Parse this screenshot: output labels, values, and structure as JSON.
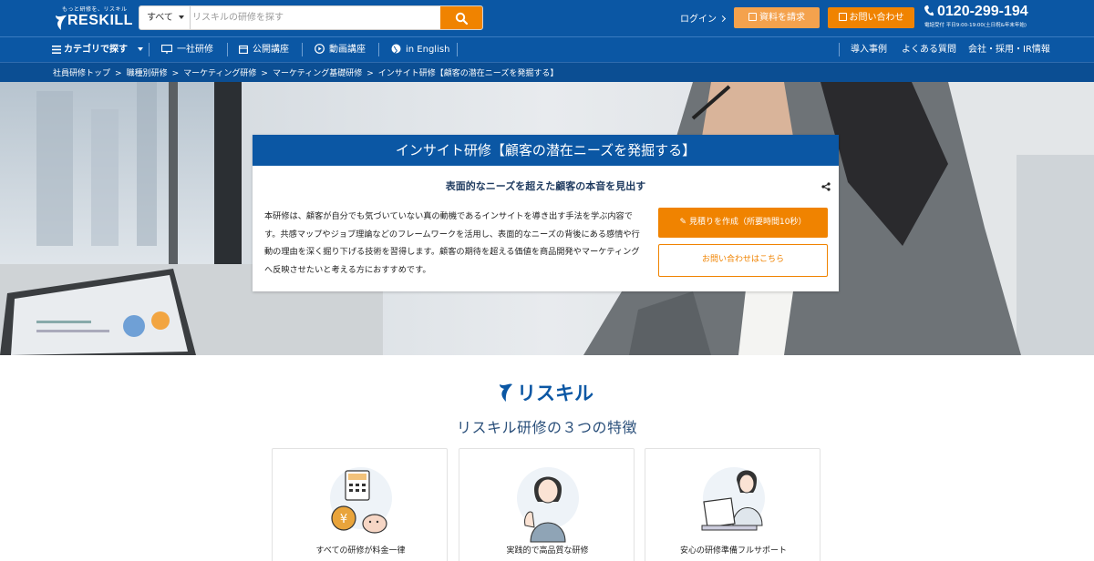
{
  "header": {
    "logo_tagline": "もっと研修を、リスキル",
    "logo_text": "RESKILL",
    "search": {
      "category": "すべて",
      "placeholder": "リスキルの研修を探す",
      "value": ""
    },
    "login_label": "ログイン",
    "request_docs_label": "資料を請求",
    "contact_label": "お問い合わせ",
    "phone_number": "0120-299-194",
    "phone_hours": "電話受付 平日9:00-19:00(土日祝&年末年始)"
  },
  "nav": {
    "categories_label": "カテゴリで探す",
    "items": [
      "一社研修",
      "公開講座",
      "動画講座",
      "in English"
    ],
    "right_items": [
      "導入事例",
      "よくある質問",
      "会社・採用・IR情報"
    ]
  },
  "breadcrumb": [
    "社員研修トップ",
    "職種別研修",
    "マーケティング研修",
    "マーケティング基礎研修",
    "インサイト研修【顧客の潜在ニーズを発掘する】"
  ],
  "hero": {
    "title": "インサイト研修【顧客の潜在ニーズを発掘する】",
    "subtitle": "表面的なニーズを超えた顧客の本音を見出す",
    "description": "本研修は、顧客が自分でも気づいていない真の動機であるインサイトを導き出す手法を学ぶ内容です。共感マップやジョブ理論などのフレームワークを活用し、表面的なニーズの背後にある感情や行動の理由を深く掘り下げる技術を習得します。顧客の期待を超える価値を商品開発やマーケティングへ反映させたいと考える方におすすめです。",
    "quote_button": "見積りを作成（所要時間10秒）",
    "inquiry_button": "お問い合わせはこちら"
  },
  "features": {
    "brand": "リスキル",
    "title": "リスキル研修の３つの特徴",
    "items": [
      {
        "label": "すべての研修が料金一律"
      },
      {
        "label": "実践的で高品質な研修"
      },
      {
        "label": "安心の研修準備フルサポート"
      }
    ]
  },
  "colors": {
    "primary": "#0b57a4",
    "accent": "#f08300"
  }
}
